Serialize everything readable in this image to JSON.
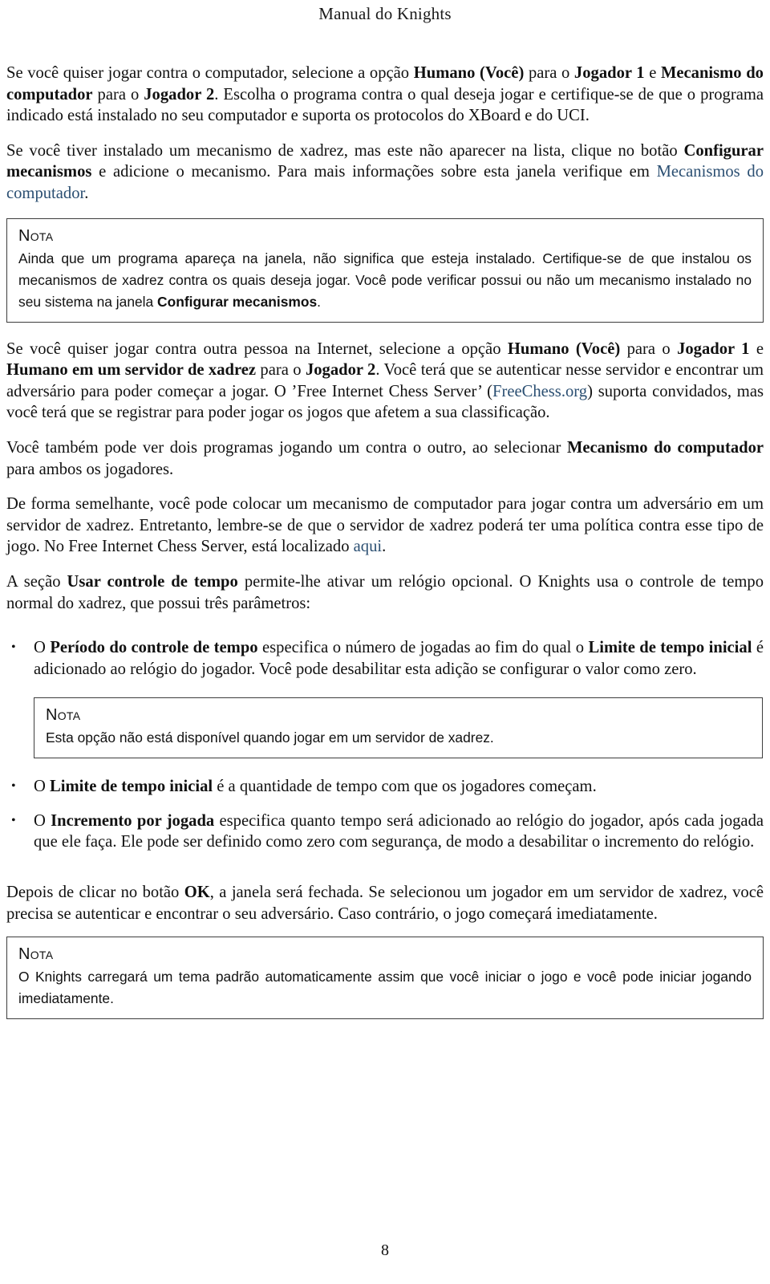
{
  "document": {
    "running_header": "Manual do Knights",
    "page_number": "8",
    "link_color": "#2b4f72"
  },
  "paragraphs": {
    "p1": {
      "s1": "Se você quiser jogar contra o computador, selecione a opção ",
      "b1": "Humano (Você)",
      "s2": " para o ",
      "b2": "Jogador 1",
      "s3": " e ",
      "b3": "Mecanismo do computador",
      "s4": " para o ",
      "b4": "Jogador 2",
      "s5": ".  Escolha o programa contra o qual deseja jogar e certifique-se de que o programa indicado está instalado no seu computador e suporta os protocolos do XBoard e do UCI."
    },
    "p2": {
      "s1": "Se você tiver instalado um mecanismo de xadrez, mas este não aparecer na lista, clique no botão ",
      "b1": "Configurar mecanismos",
      "s2": " e adicione o mecanismo.  Para mais informações sobre esta janela verifique em ",
      "link1": "Mecanismos do computador",
      "s3": "."
    },
    "p3": {
      "s1": "Se você quiser jogar contra outra pessoa na Internet, selecione a opção ",
      "b1": "Humano (Você)",
      "s2": " para o ",
      "b2": "Jogador 1",
      "s3": " e ",
      "b3": "Humano em um servidor de xadrez",
      "s4": " para o ",
      "b4": "Jogador 2",
      "s5": ".  Você terá que se autenticar nesse servidor e encontrar um adversário para poder começar a jogar.  O ’Free Internet Chess Server’ (",
      "link1": "FreeChess.org",
      "s6": ") suporta convidados, mas você terá que se registrar para poder jogar os jogos que afetem a sua classificação."
    },
    "p4": {
      "s1": "Você também pode ver dois programas jogando um contra o outro, ao selecionar ",
      "b1": "Mecanismo do computador",
      "s2": " para ambos os jogadores."
    },
    "p5": {
      "s1": "De forma semelhante, você pode colocar um mecanismo de computador para jogar contra um adversário em um servidor de xadrez. Entretanto, lembre-se de que o servidor de xadrez poderá ter uma política contra esse tipo de jogo. No Free Internet Chess Server, está localizado ",
      "link1": "aqui",
      "s2": "."
    },
    "p6": {
      "s1": "A seção ",
      "b1": "Usar controle de tempo",
      "s2": " permite-lhe ativar um relógio opcional. O Knights usa o controle de tempo normal do xadrez, que possui três parâmetros:"
    },
    "p7": {
      "s1": "Depois de clicar no botão ",
      "b1": "OK",
      "s2": ", a janela será fechada. Se selecionou um jogador em um servidor de xadrez, você precisa se autenticar e encontrar o seu adversário. Caso contrário, o jogo começará imediatamente."
    }
  },
  "bullets": {
    "bullet_char": "•",
    "item1": {
      "s1": "O ",
      "b1": "Período do controle de tempo",
      "s2": " especifica o número de jogadas ao fim do qual o ",
      "b2": "Limite de tempo inicial",
      "s3": " é adicionado ao relógio do jogador.  Você pode desabilitar esta adição se configurar o valor como zero."
    },
    "item2": {
      "s1": "O ",
      "b1": "Limite de tempo inicial",
      "s2": " é a quantidade de tempo com que os jogadores começam."
    },
    "item3": {
      "s1": "O ",
      "b1": "Incremento por jogada",
      "s2": " especifica quanto tempo será adicionado ao relógio do jogador, após cada jogada que ele faça. Ele pode ser definido como zero com segurança, de modo a desabilitar o incremento do relógio."
    }
  },
  "notes": {
    "note1": {
      "title": "Nota",
      "s1": "Ainda que um programa apareça na janela, não significa que esteja instalado.  Certifique-se de que instalou os mecanismos de xadrez contra os quais deseja jogar.  Você pode verificar possui ou não um mecanismo instalado no seu sistema na janela ",
      "b1": "Configurar mecanismos",
      "s2": "."
    },
    "note2": {
      "title": "Nota",
      "s1": "Esta opção não está disponível quando jogar em um servidor de xadrez."
    },
    "note3": {
      "title": "Nota",
      "s1": "O Knights carregará um tema padrão automaticamente assim que você iniciar o jogo e você pode iniciar jogando imediatamente."
    }
  }
}
